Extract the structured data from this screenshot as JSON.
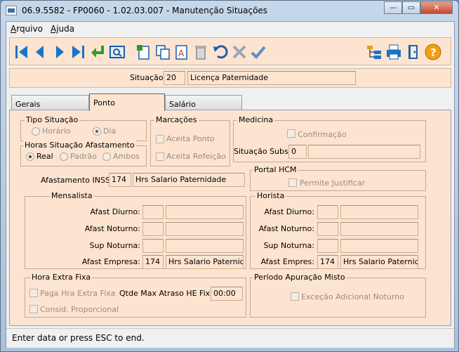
{
  "window": {
    "title": "06.9.5582 - FP0060 - 1.02.03.007 - Manutenção Situações",
    "minimize": "—",
    "maximize": "▭",
    "close": "✕"
  },
  "menu": {
    "arquivo_first": "A",
    "arquivo_rest": "rquivo",
    "ajuda_first": "Aj",
    "ajuda_rest": "uda"
  },
  "toolbar": {
    "icons": [
      "first-record-icon",
      "prev-record-icon",
      "next-record-icon",
      "last-record-icon",
      "enter-icon",
      "search-icon",
      "new-record-icon",
      "copy-icon",
      "spellcheck-icon",
      "delete-icon",
      "undo-icon",
      "cancel-icon",
      "confirm-icon",
      "tree-icon",
      "print-icon",
      "exit-icon",
      "help-icon"
    ],
    "accent": "#1b73c9"
  },
  "situacao": {
    "label": "Situação:",
    "code": "20",
    "description": "Licença Paternidade"
  },
  "tabs": [
    "Gerais",
    "Ponto",
    "Salário"
  ],
  "ponto": {
    "tipo_situacao": {
      "title": "Tipo Situação",
      "opt_horario": "Horário",
      "opt_dia": "Dia"
    },
    "horas_afastamento": {
      "title": "Horas Situação Afastamento",
      "opt_real": "Real",
      "opt_padrao": "Padrão",
      "opt_ambos": "Ambos"
    },
    "marcacoes": {
      "title": "Marcações",
      "aceita_ponto": "Aceita Ponto",
      "aceita_refeicao": "Aceita Refeição"
    },
    "medicina": {
      "title": "Medicina",
      "confirmacao": "Confirmação",
      "situacao_subst_label": "Situação Subst:",
      "situacao_subst_value": "0",
      "situacao_subst_desc": ""
    },
    "afastamento_inss": {
      "label": "Afastamento INSS:",
      "code": "174",
      "desc": "Hrs Salario Paternidade"
    },
    "portal_hcm": {
      "title": "Portal HCM",
      "permite_justificar": "Permite Justificar"
    },
    "mensalista": {
      "title": "Mensalista",
      "afast_diurno": "Afast Diurno:",
      "afast_noturno": "Afast Noturno:",
      "sup_noturna": "Sup Noturna:",
      "afast_empresa": "Afast Empresa:",
      "empresa_code": "174",
      "empresa_desc": "Hrs Salario Paternidad"
    },
    "horista": {
      "title": "Horista",
      "afast_diurno": "Afast Diurno:",
      "afast_noturno": "Afast Noturno:",
      "sup_noturna": "Sup Noturna:",
      "afast_empres": "Afast Empres:",
      "empres_code": "174",
      "empres_desc": "Hrs Salario Paternidad"
    },
    "hora_extra": {
      "title": "Hora Extra Fixa",
      "paga_hra": "Paga Hra Extra Fixa",
      "consid": "Consid. Proporcional",
      "qtde_label": "Qtde Max Atraso HE Fixa:",
      "qtde_value": "00:00"
    },
    "periodo_apuracao": {
      "title": "Período Apuração Misto",
      "excecao": "Exceção Adicional Noturno"
    }
  },
  "status": "Enter data or press ESC to end."
}
